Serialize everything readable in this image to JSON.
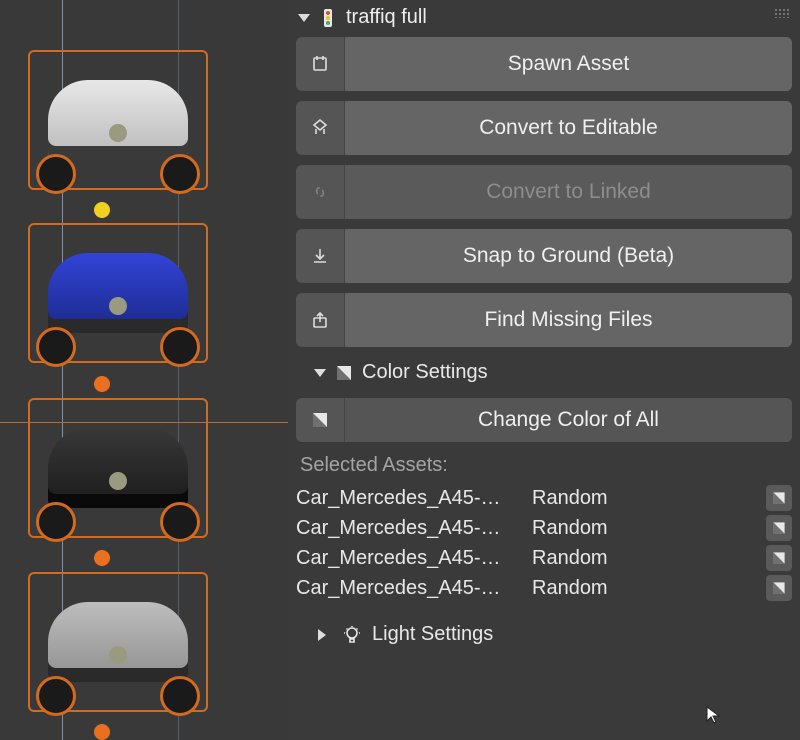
{
  "panel": {
    "title": "traffiq full",
    "buttons": {
      "spawn": "Spawn Asset",
      "convert_editable": "Convert to Editable",
      "convert_linked": "Convert to Linked",
      "snap_ground": "Snap to Ground (Beta)",
      "find_missing": "Find Missing Files"
    },
    "color_section": {
      "title": "Color Settings",
      "change_all": "Change Color of All",
      "selected_label": "Selected Assets:",
      "assets": [
        {
          "name": "Car_Mercedes_A45-…",
          "mode": "Random"
        },
        {
          "name": "Car_Mercedes_A45-…",
          "mode": "Random"
        },
        {
          "name": "Car_Mercedes_A45-…",
          "mode": "Random"
        },
        {
          "name": "Car_Mercedes_A45-…",
          "mode": "Random"
        }
      ]
    },
    "light_section": {
      "title": "Light Settings"
    }
  }
}
